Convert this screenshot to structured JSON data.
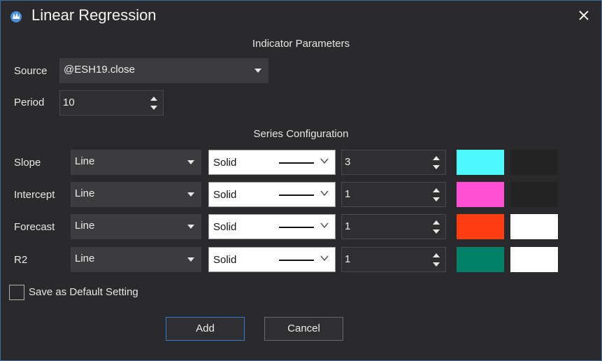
{
  "window": {
    "title": "Linear Regression"
  },
  "indicator": {
    "section_title": "Indicator Parameters",
    "source_label": "Source",
    "source_value": "@ESH19.close",
    "period_label": "Period",
    "period_value": "10"
  },
  "series_config": {
    "section_title": "Series Configuration",
    "rows": [
      {
        "label": "Slope",
        "type": "Line",
        "style": "Solid",
        "width": "3",
        "color": "#4cf9ff",
        "bg_color": "#242424"
      },
      {
        "label": "Intercept",
        "type": "Line",
        "style": "Solid",
        "width": "1",
        "color": "#ff4fd2",
        "bg_color": "#242424"
      },
      {
        "label": "Forecast",
        "type": "Line",
        "style": "Solid",
        "width": "1",
        "color": "#ff3d10",
        "bg_color": "#ffffff"
      },
      {
        "label": "R2",
        "type": "Line",
        "style": "Solid",
        "width": "1",
        "color": "#008068",
        "bg_color": "#ffffff"
      }
    ]
  },
  "default_setting": {
    "label": "Save as Default Setting",
    "checked": false
  },
  "buttons": {
    "add": "Add",
    "cancel": "Cancel"
  },
  "colors": {
    "accent": "#3a6ea5",
    "background": "#2a2a2c"
  }
}
